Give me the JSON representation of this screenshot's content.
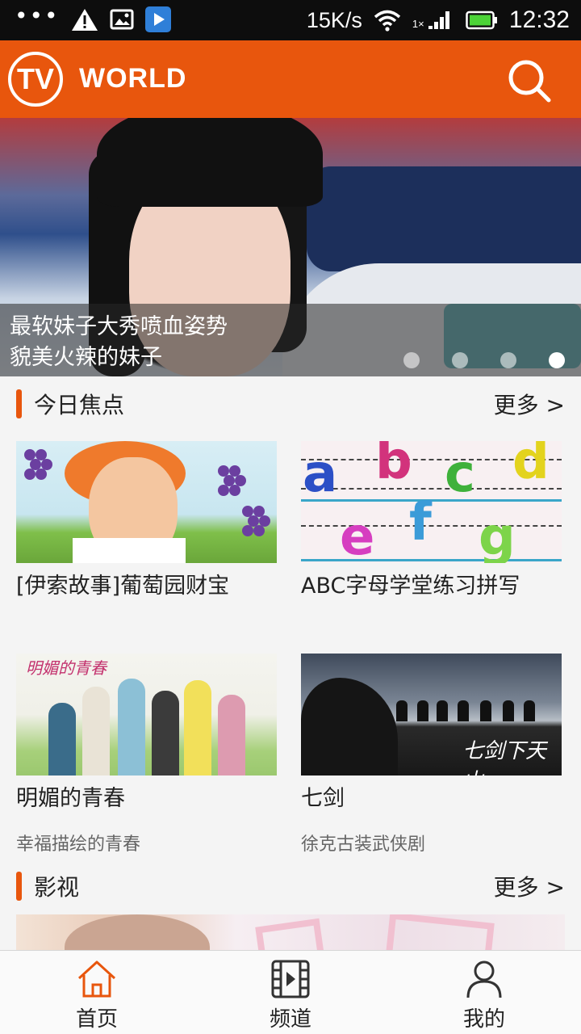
{
  "status_bar": {
    "dots": "•••",
    "net_speed": "15K/s",
    "sim_label": "1×",
    "time": "12:32",
    "icons": [
      "warning-icon",
      "image-icon",
      "play-store-icon",
      "wifi-icon",
      "signal-icon",
      "battery-icon"
    ]
  },
  "header": {
    "logo_text": "TV",
    "brand": "WORLD",
    "accent_color": "#e8560d"
  },
  "banner": {
    "caption_line1": "最软妹子大秀喷血姿势",
    "caption_line2": "貌美火辣的妹子",
    "slide_count": 4,
    "active_slide": 4
  },
  "focus_section": {
    "title": "今日焦点",
    "more": "更多 >",
    "cards": [
      {
        "title": "[伊索故事]葡萄园财宝",
        "subtitle": ""
      },
      {
        "title": "ABC字母学堂练习拼写",
        "subtitle": ""
      },
      {
        "title": "明媚的青春",
        "subtitle": "幸福描绘的青春"
      },
      {
        "title": "七剑",
        "subtitle": "徐克古装武侠剧"
      }
    ],
    "thumb_texts": {
      "letters": [
        "a",
        "b",
        "c",
        "d",
        "e",
        "f",
        "g"
      ],
      "poster_logo": "明媚的青春",
      "sword_mark": "七剑下天山"
    }
  },
  "film_section": {
    "title": "影视",
    "more": "更多 >"
  },
  "bottom_nav": {
    "items": [
      {
        "label": "首页",
        "icon": "home-icon",
        "active": true
      },
      {
        "label": "频道",
        "icon": "film-icon",
        "active": false
      },
      {
        "label": "我的",
        "icon": "user-icon",
        "active": false
      }
    ],
    "active_color": "#e8560d"
  }
}
